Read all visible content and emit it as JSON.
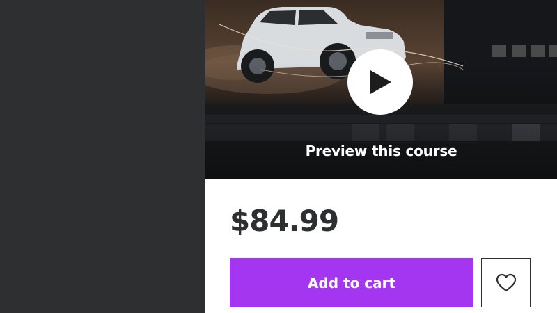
{
  "preview": {
    "label": "Preview this course",
    "play_icon": "play-icon"
  },
  "purchase": {
    "price": "$84.99",
    "add_to_cart_label": "Add to cart",
    "wishlist_icon": "heart-icon"
  },
  "colors": {
    "background": "#2d2f31",
    "card": "#ffffff",
    "accent": "#a435f0",
    "text": "#2d2f31"
  }
}
